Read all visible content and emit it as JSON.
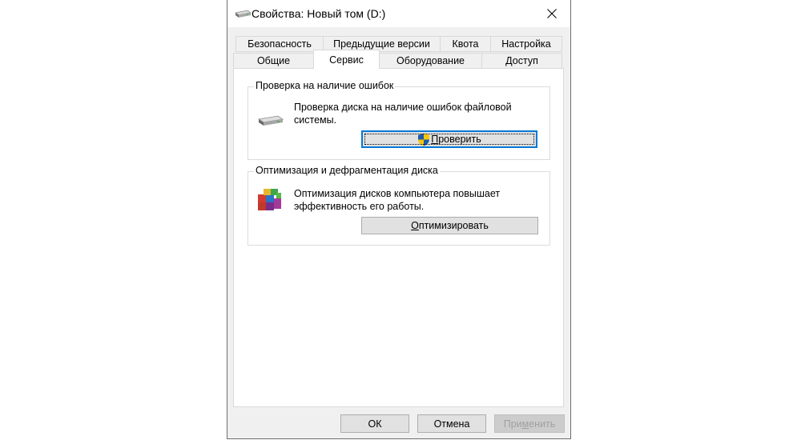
{
  "window": {
    "title": "Свойства: Новый том (D:)",
    "close_icon": "close-icon"
  },
  "tabs": {
    "row_top": [
      {
        "label": "Безопасность"
      },
      {
        "label": "Предыдущие версии"
      },
      {
        "label": "Квота"
      },
      {
        "label": "Настройка"
      }
    ],
    "row_bottom": [
      {
        "label": "Общие"
      },
      {
        "label": "Сервис",
        "active": true
      },
      {
        "label": "Оборудование"
      },
      {
        "label": "Доступ"
      }
    ]
  },
  "error_check": {
    "group_title": "Проверка на наличие ошибок",
    "description": "Проверка диска на наличие ошибок файловой системы.",
    "icon": "drive-icon",
    "button_label": "Проверить",
    "button_first": "П",
    "button_rest": "роверить",
    "button_icon": "uac-shield-icon"
  },
  "optimize": {
    "group_title": "Оптимизация и дефрагментация диска",
    "description": "Оптимизация дисков компьютера повышает эффективность его работы.",
    "icon": "defrag-icon",
    "button_label": "Оптимизировать",
    "button_first": "О",
    "button_rest": "птимизировать"
  },
  "footer": {
    "ok_label": "ОК",
    "cancel_label": "Отмена",
    "apply_label": "Применить",
    "apply_pre": "При",
    "apply_u": "м",
    "apply_post": "енить"
  }
}
